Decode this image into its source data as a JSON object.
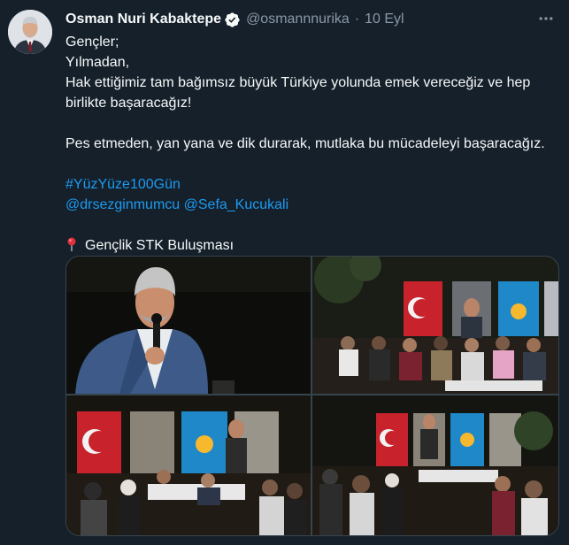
{
  "tweet": {
    "author_name": "Osman Nuri Kabaktepe",
    "handle": "@osmannnurika",
    "separator": "·",
    "date": "10 Eyl",
    "lines": [
      "Gençler;",
      "Yılmadan,",
      "Hak ettiğimiz tam bağımsız büyük Türkiye yolunda emek vereceğiz ve hep birlikte başaracağız!"
    ],
    "paragraph2": "Pes etmeden, yan yana ve dik durarak, mutlaka bu mücadeleyi başaracağız.",
    "hashtag": "#YüzYüze100Gün",
    "mention1": "@drsezginmumcu",
    "mention2": "@Sefa_Kucukali",
    "location": "Gençlik STK Buluşması"
  },
  "icons": {
    "verified": "verified-badge-icon",
    "more": "more-options-icon",
    "pin": "round-pushpin-icon"
  },
  "colors": {
    "background": "#15202b",
    "link": "#1d9bf0",
    "muted": "#8b98a5",
    "verified": "#f7f9f9"
  }
}
